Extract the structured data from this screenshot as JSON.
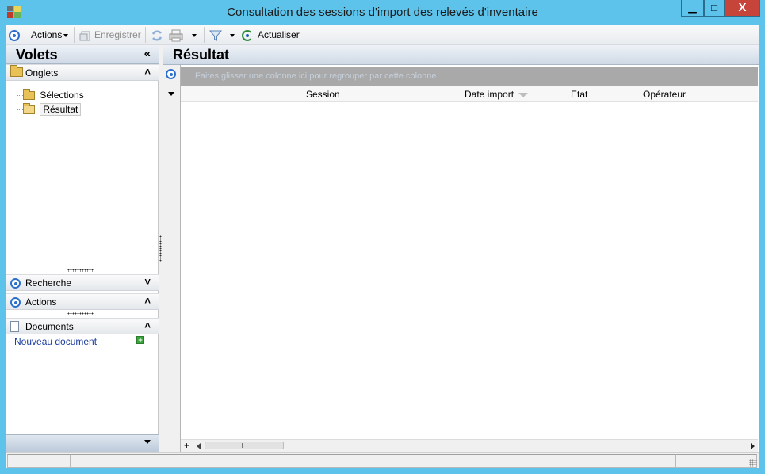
{
  "window": {
    "title": "Consultation des sessions d'import des relevés d'inventaire",
    "controls": {
      "minimize": "▁",
      "maximize": "□",
      "close": "X"
    }
  },
  "toolbar": {
    "actions_label": "Actions",
    "save_label": "Enregistrer",
    "refresh_label": "Actualiser"
  },
  "left_pane": {
    "title": "Volets",
    "collapse_glyph": "«",
    "onglets": {
      "label": "Onglets",
      "items": [
        {
          "label": "Sélections",
          "selected": false
        },
        {
          "label": "Résultat",
          "selected": true
        }
      ]
    },
    "recherche": {
      "label": "Recherche",
      "state_glyph": "»"
    },
    "actions": {
      "label": "Actions",
      "state_glyph": "«"
    },
    "documents": {
      "label": "Documents",
      "state_glyph": "«",
      "new_document": "Nouveau document"
    }
  },
  "result": {
    "title": "Résultat",
    "group_panel_hint": "Faites glisser une colonne ici pour regrouper par cette colonne",
    "columns": [
      "Session",
      "Date import",
      "Etat",
      "Opérateur"
    ],
    "rows": []
  },
  "colors": {
    "window_border": "#5ec3eb",
    "close_button": "#c7443b",
    "accent_blue": "#2d6fcc",
    "link": "#1b3f9e"
  }
}
